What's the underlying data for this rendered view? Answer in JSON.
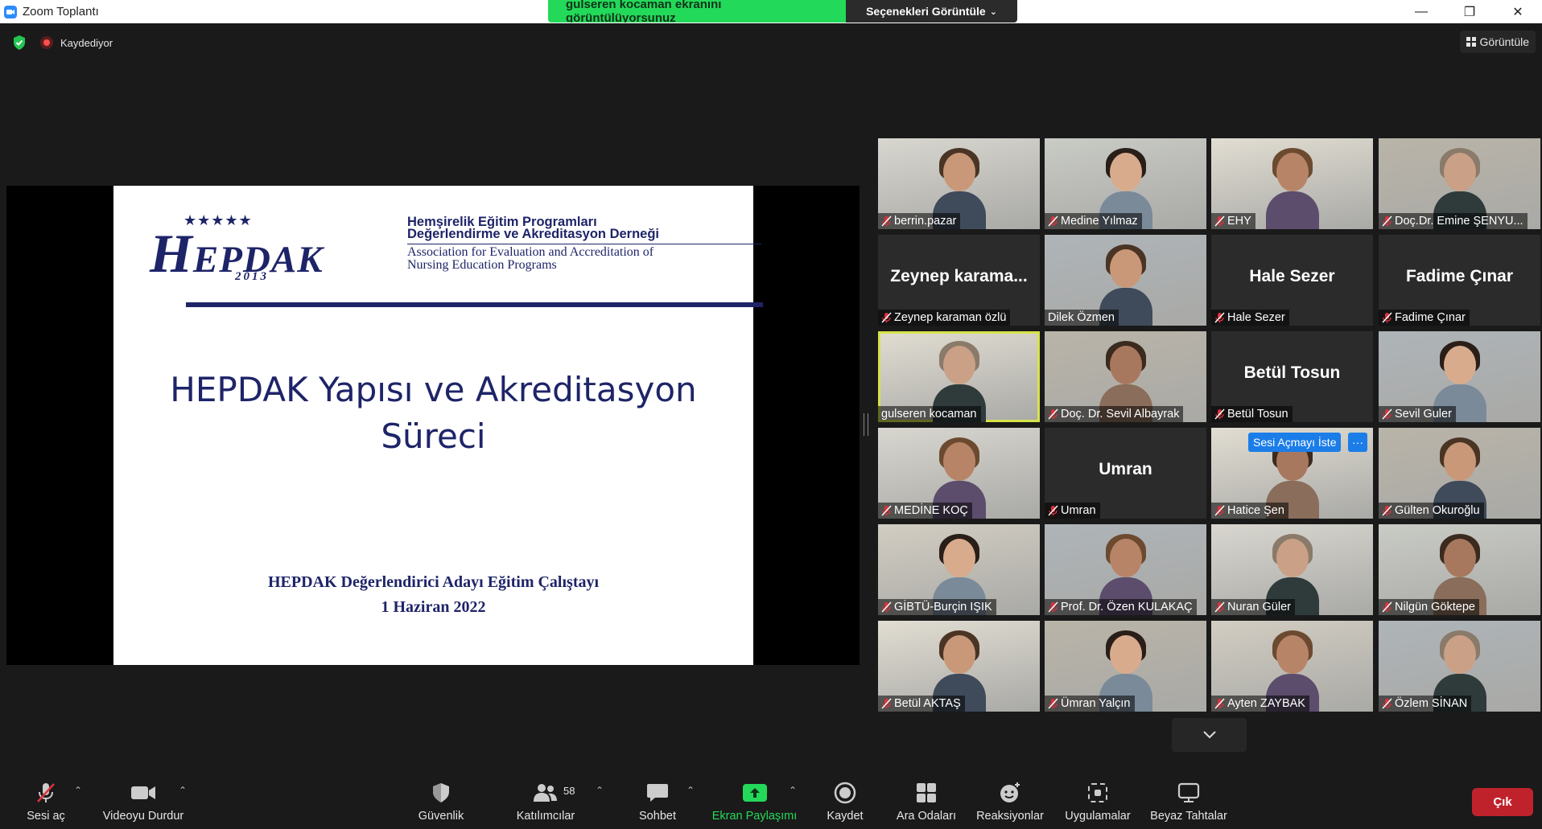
{
  "window": {
    "title": "Zoom Toplantı",
    "minimize": "—",
    "restore": "❐",
    "close": "✕"
  },
  "share_banner": {
    "message": "gulseren kocaman ekranını görüntülüyorsunuz",
    "options_label": "Seçenekleri Görüntüle"
  },
  "status": {
    "recording_label": "Kaydediyor",
    "view_label": "Görüntüle"
  },
  "slide": {
    "logo_stars": "★★★★★",
    "logo_initial": "H",
    "logo_rest": "EPDAK",
    "logo_year": "2013",
    "logo_tr_line1": "Hemşirelik Eğitim Programları",
    "logo_tr_line2": "Değerlendirme ve Akreditasyon Derneği",
    "logo_en_line1": "Association for Evaluation and Accreditation of",
    "logo_en_line2": "Nursing Education Programs",
    "title_line1": "HEPDAK  Yapısı ve Akreditasyon",
    "title_line2": "Süreci",
    "subtitle_line1": "HEPDAK Değerlendirici Adayı Eğitim Çalıştayı",
    "subtitle_line2": "1 Haziran 2022"
  },
  "participants": [
    {
      "name": "berrin.pazar",
      "video": true,
      "muted": true
    },
    {
      "name": "Medine Yılmaz",
      "video": true,
      "muted": true
    },
    {
      "name": "EHY",
      "video": true,
      "muted": true
    },
    {
      "name": "Doç.Dr. Emine ŞENYU...",
      "video": true,
      "muted": true
    },
    {
      "name": "Zeynep karaman özlü",
      "big_name": "Zeynep  karama...",
      "video": false,
      "muted": true
    },
    {
      "name": "Dilek Özmen",
      "video": true,
      "muted": false
    },
    {
      "name": "Hale Sezer",
      "big_name": "Hale Sezer",
      "video": false,
      "muted": true
    },
    {
      "name": "Fadime Çınar",
      "big_name": "Fadime Çınar",
      "video": false,
      "muted": true
    },
    {
      "name": "gulseren kocaman",
      "video": true,
      "muted": false,
      "active": true
    },
    {
      "name": "Doç. Dr. Sevil Albayrak",
      "video": true,
      "muted": true
    },
    {
      "name": "Betül Tosun",
      "big_name": "Betül Tosun",
      "video": false,
      "muted": true
    },
    {
      "name": "Sevil Guler",
      "video": true,
      "muted": true
    },
    {
      "name": "MEDİNE KOÇ",
      "video": true,
      "muted": true
    },
    {
      "name": "Umran",
      "big_name": "Umran",
      "video": false,
      "muted": true
    },
    {
      "name": "Hatice Şen",
      "video": true,
      "muted": true,
      "unmute_request": "Sesi Açmayı İste",
      "more": "···"
    },
    {
      "name": "Gülten Okuroğlu",
      "video": true,
      "muted": true
    },
    {
      "name": "GİBTÜ-Burçin IŞIK",
      "video": true,
      "muted": true
    },
    {
      "name": "Prof. Dr. Özen KULAKAÇ",
      "video": true,
      "muted": true
    },
    {
      "name": "Nuran Güler",
      "video": true,
      "muted": true
    },
    {
      "name": "Nilgün Göktepe",
      "video": true,
      "muted": true
    },
    {
      "name": "Betül AKTAŞ",
      "video": true,
      "muted": true
    },
    {
      "name": "Ümran Yalçın",
      "video": true,
      "muted": true
    },
    {
      "name": "Ayten ZAYBAK",
      "video": true,
      "muted": true
    },
    {
      "name": "Özlem SİNAN",
      "video": true,
      "muted": true
    }
  ],
  "toolbar": {
    "unmute": "Sesi aç",
    "stop_video": "Videoyu Durdur",
    "security": "Güvenlik",
    "participants": "Katılımcılar",
    "participants_count": "58",
    "chat": "Sohbet",
    "share_screen": "Ekran Paylaşımı",
    "record": "Kaydet",
    "breakout": "Ara Odaları",
    "reactions": "Reaksiyonlar",
    "apps": "Uygulamalar",
    "whiteboards": "Beyaz Tahtalar",
    "leave": "Çık",
    "caret": "⌃"
  },
  "colors": {
    "share_green": "#23d959",
    "leave_red": "#c0222c",
    "slide_navy": "#1e2468",
    "active_speaker": "#d6e34a"
  }
}
